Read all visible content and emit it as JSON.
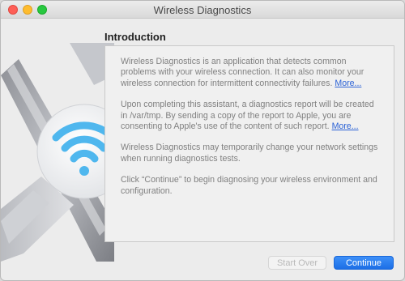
{
  "window": {
    "title": "Wireless Diagnostics"
  },
  "main": {
    "heading": "Introduction",
    "paragraphs": [
      {
        "text": "Wireless Diagnostics is an application that detects common problems with your wireless connection. It can also monitor your wireless connection for intermittent connectivity failures. ",
        "link": "More..."
      },
      {
        "text": "Upon completing this assistant, a diagnostics report will be created in /var/tmp. By sending a copy of the report to Apple, you are consenting to Apple's use of the content of such report. ",
        "link": "More..."
      },
      {
        "text": "Wireless Diagnostics may temporarily change your network settings when running diagnostics tests."
      },
      {
        "text": "Click “Continue” to begin diagnosing your wireless environment and configuration."
      }
    ]
  },
  "buttons": {
    "start_over": "Start Over",
    "continue": "Continue"
  },
  "colors": {
    "link": "#2b62d6",
    "accent": "#1c6fe6",
    "wifi": "#4fb7ee"
  },
  "icons": {
    "app_art": "wireless-diagnostics-tools-icon",
    "wifi": "wifi-icon"
  }
}
